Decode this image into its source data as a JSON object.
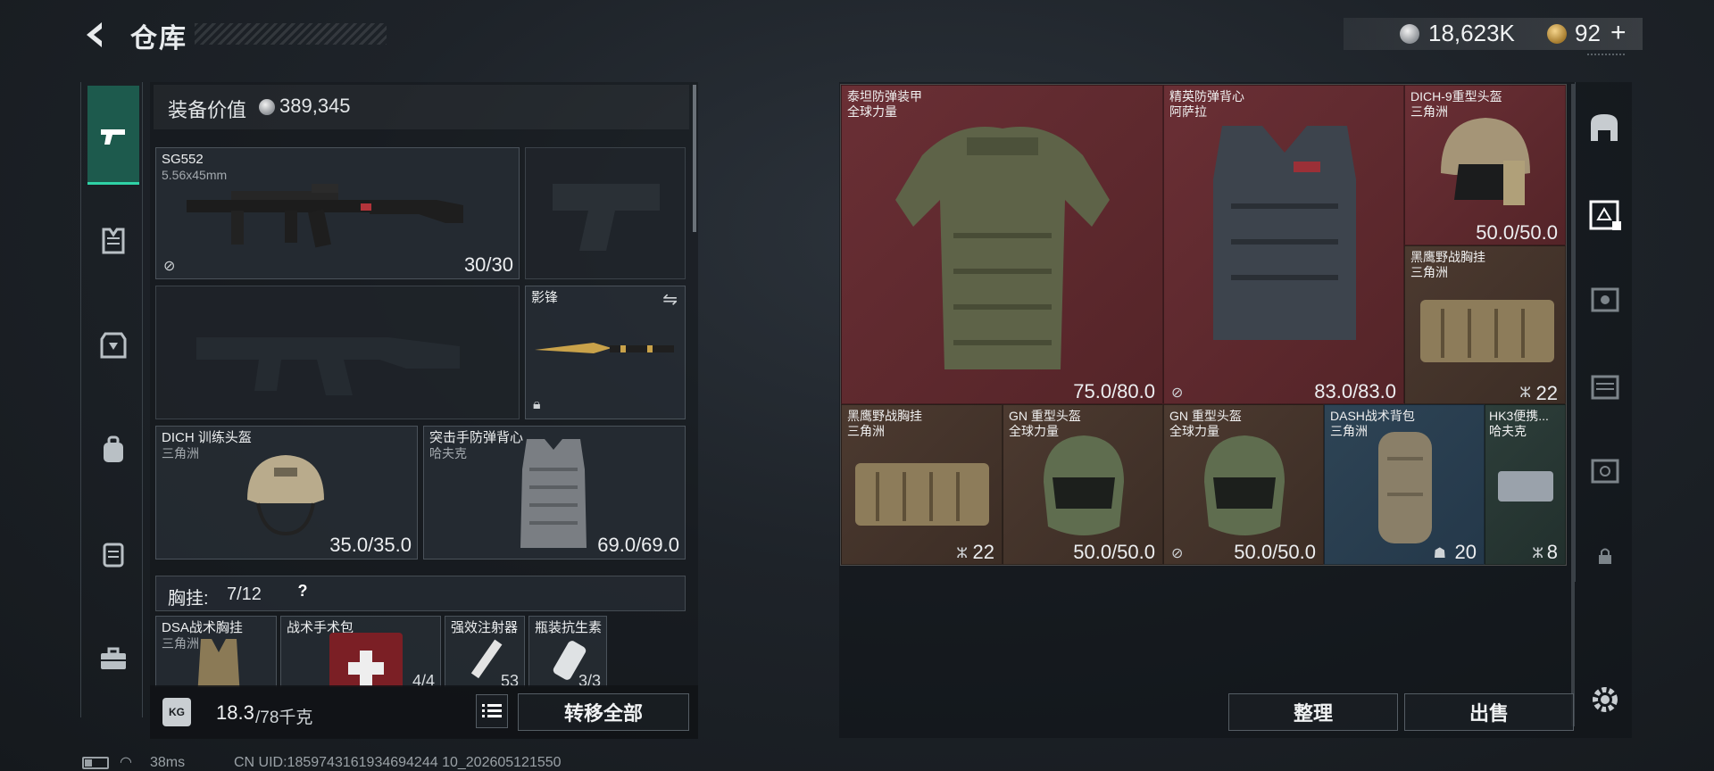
{
  "header": {
    "title": "仓库",
    "silver": "18,623K",
    "gold": "92",
    "plus": "+"
  },
  "equipment": {
    "value_label": "装备价值",
    "value": "389,345",
    "primary_weapon": {
      "name": "SG552",
      "caliber": "5.56x45mm",
      "ammo": "30/30"
    },
    "melee": {
      "name": "影锋"
    },
    "helmet": {
      "name": "DICH 训练头盔",
      "maker": "三角洲",
      "durability": "35.0/35.0"
    },
    "armor": {
      "name": "突击手防弹背心",
      "maker": "哈夫克",
      "durability": "69.0/69.0"
    }
  },
  "rig": {
    "label": "胸挂:",
    "count": "7/12",
    "help": "?",
    "items": [
      {
        "name": "DSA战术胸挂",
        "sub": "三角洲"
      },
      {
        "name": "战术手术包",
        "sub": "",
        "count": "4/4"
      },
      {
        "name": "强效注射器",
        "sub": "",
        "count": "53"
      },
      {
        "name": "瓶装抗生素",
        "sub": "",
        "count": "3/3"
      }
    ]
  },
  "bottom": {
    "weight": "18.3",
    "weight_max": "/78千克",
    "kg_icon": "KG",
    "transfer_all": "转移全部",
    "sort": "整理",
    "sell": "出售"
  },
  "warehouse": [
    {
      "name": "泰坦防弹装甲",
      "maker": "全球力量",
      "value": "75.0/80.0",
      "color": "red"
    },
    {
      "name": "精英防弹背心",
      "maker": "阿萨拉",
      "value": "83.0/83.0",
      "color": "red"
    },
    {
      "name": "DICH-9重型头盔",
      "maker": "三角洲",
      "value": "50.0/50.0",
      "color": "red"
    },
    {
      "name": "黑鹰野战胸挂",
      "maker": "三角洲",
      "value": "22",
      "color": "brown"
    },
    {
      "name": "黑鹰野战胸挂",
      "maker": "三角洲",
      "value": "22",
      "color": "brown"
    },
    {
      "name": "GN 重型头盔",
      "maker": "全球力量",
      "value": "50.0/50.0",
      "color": "brown"
    },
    {
      "name": "GN 重型头盔",
      "maker": "全球力量",
      "value": "50.0/50.0",
      "color": "brown"
    },
    {
      "name": "DASH战术背包",
      "maker": "三角洲",
      "value": "20",
      "color": "blue"
    },
    {
      "name": "HK3便携...",
      "maker": "哈夫克",
      "value": "8",
      "color": "green"
    }
  ],
  "status": {
    "ping": "38ms",
    "uid": "CN UID:1859743161934694244 10_202605121550"
  },
  "colors": {
    "accent": "#2fd3a6",
    "red_cell": "#6a2f35",
    "brown_cell": "#4c3a30",
    "blue_cell": "#2e4455"
  }
}
